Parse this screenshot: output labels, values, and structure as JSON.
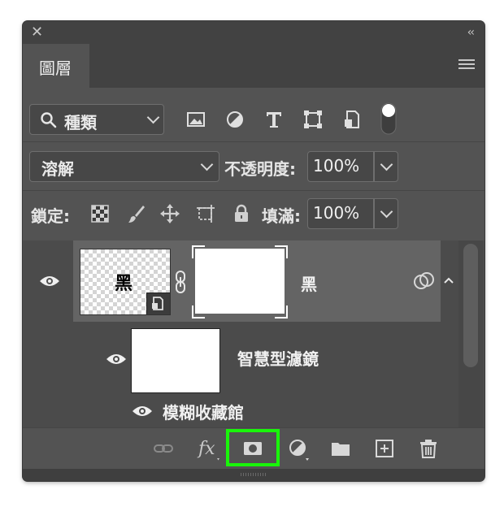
{
  "panel": {
    "title": "圖層"
  },
  "filter": {
    "kind_label": "種類"
  },
  "blend": {
    "mode": "溶解",
    "opacity_label": "不透明度:",
    "opacity_value": "100%"
  },
  "lock": {
    "label": "鎖定:",
    "fill_label": "填滿:",
    "fill_value": "100%"
  },
  "layers": {
    "main": {
      "name": "黑",
      "thumb_char": "黑"
    },
    "smart_filters_label": "智慧型濾鏡",
    "filter_item": "模糊收藏館"
  },
  "colors": {
    "panel_bg": "#535353",
    "highlight": "#19f50a",
    "selected_row": "#646464"
  },
  "icons": [
    "close-icon",
    "collapse-icon",
    "panel-menu-icon",
    "search-icon",
    "image-filter-icon",
    "adjustment-filter-icon",
    "type-filter-icon",
    "shape-filter-icon",
    "smart-object-filter-icon",
    "filter-toggle-icon",
    "lock-transparent-icon",
    "lock-paint-icon",
    "lock-move-icon",
    "lock-artboard-icon",
    "lock-all-icon",
    "eye-icon",
    "link-icon",
    "fx-icon",
    "add-mask-icon",
    "adjustment-layer-icon",
    "group-icon",
    "new-layer-icon",
    "trash-icon"
  ]
}
